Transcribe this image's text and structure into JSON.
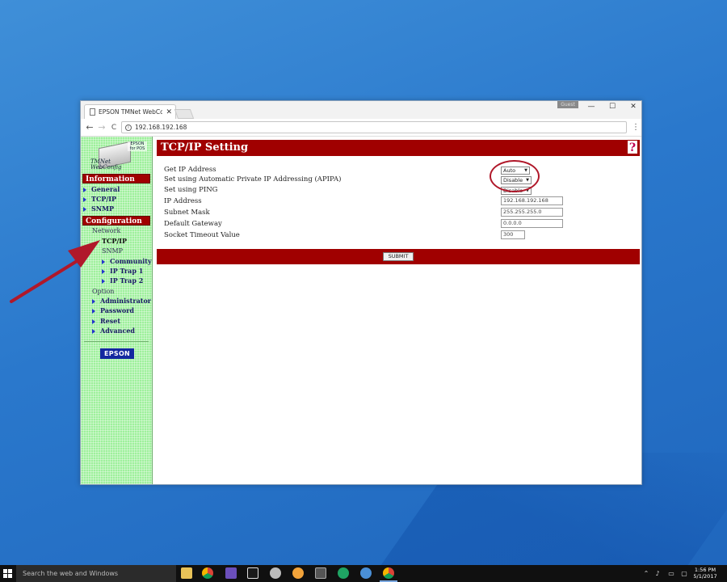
{
  "browser": {
    "tab_title": "EPSON TMNet WebConf",
    "tab_close": "✕",
    "guest_label": "Guest",
    "url": "192.168.192.168",
    "controls": {
      "minimize": "—",
      "maximize": "☐",
      "close": "✕"
    },
    "nav": {
      "back": "←",
      "forward": "→",
      "reload": "C",
      "menu": "⋮"
    }
  },
  "sidebar": {
    "logo": {
      "badge": "EPSON for POS",
      "name": "TMNet WebConfig"
    },
    "information_header": "Information",
    "information_items": [
      "General",
      "TCP/IP",
      "SNMP"
    ],
    "configuration_header": "Configuration",
    "network_label": "Network",
    "network_current": "TCP/IP",
    "snmp_label": "SNMP",
    "snmp_items": [
      "Community",
      "IP Trap 1",
      "IP Trap 2"
    ],
    "option_label": "Option",
    "option_items": [
      "Administrator",
      "Password",
      "Reset",
      "Advanced"
    ],
    "brand_logo": "EPSON"
  },
  "main": {
    "title": "TCP/IP Setting",
    "help": "?",
    "fields": {
      "get_ip": {
        "label": "Get IP Address",
        "value": "Auto"
      },
      "apipa": {
        "label": "Set using Automatic Private IP Addressing (APIPA)",
        "value": "Disable"
      },
      "ping": {
        "label": "Set using PING",
        "value": "Disable"
      },
      "ip": {
        "label": "IP Address",
        "value": "192.168.192.168"
      },
      "mask": {
        "label": "Subnet Mask",
        "value": "255.255.255.0"
      },
      "gateway": {
        "label": "Default Gateway",
        "value": "0.0.0.0"
      },
      "timeout": {
        "label": "Socket Timeout Value",
        "value": "300"
      }
    },
    "submit_label": "SUBMIT"
  },
  "taskbar": {
    "search_placeholder": "Search the web and Windows",
    "time": "1:56 PM",
    "date": "5/1/2017"
  },
  "colors": {
    "header_red": "#a00000",
    "sidebar_green": "#9ef09c",
    "annotation_red": "#b0182a",
    "epson_blue": "#1428a0"
  }
}
